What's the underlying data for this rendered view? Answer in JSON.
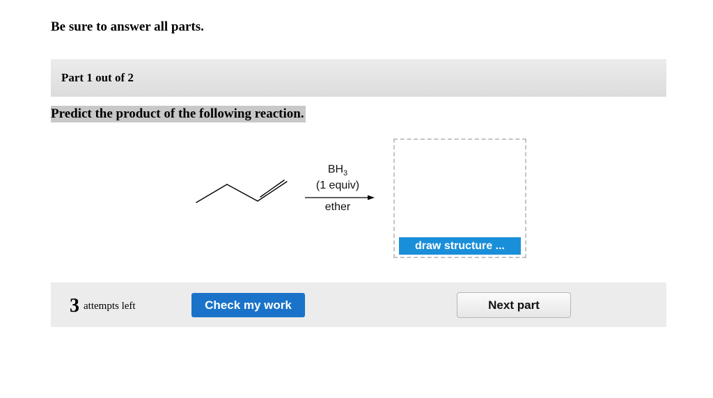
{
  "instructions": "Be sure to answer all parts.",
  "part_header": "Part 1 out of 2",
  "question": "Predict the product of the following reaction.",
  "reaction": {
    "reagent_formula": "BH",
    "reagent_subscript": "3",
    "reagent_condition": "(1 equiv)",
    "solvent": "ether"
  },
  "answer_box": {
    "draw_label": "draw structure ..."
  },
  "footer": {
    "attempts_count": "3",
    "attempts_label": "attempts left",
    "check_label": "Check my work",
    "next_label": "Next part"
  }
}
